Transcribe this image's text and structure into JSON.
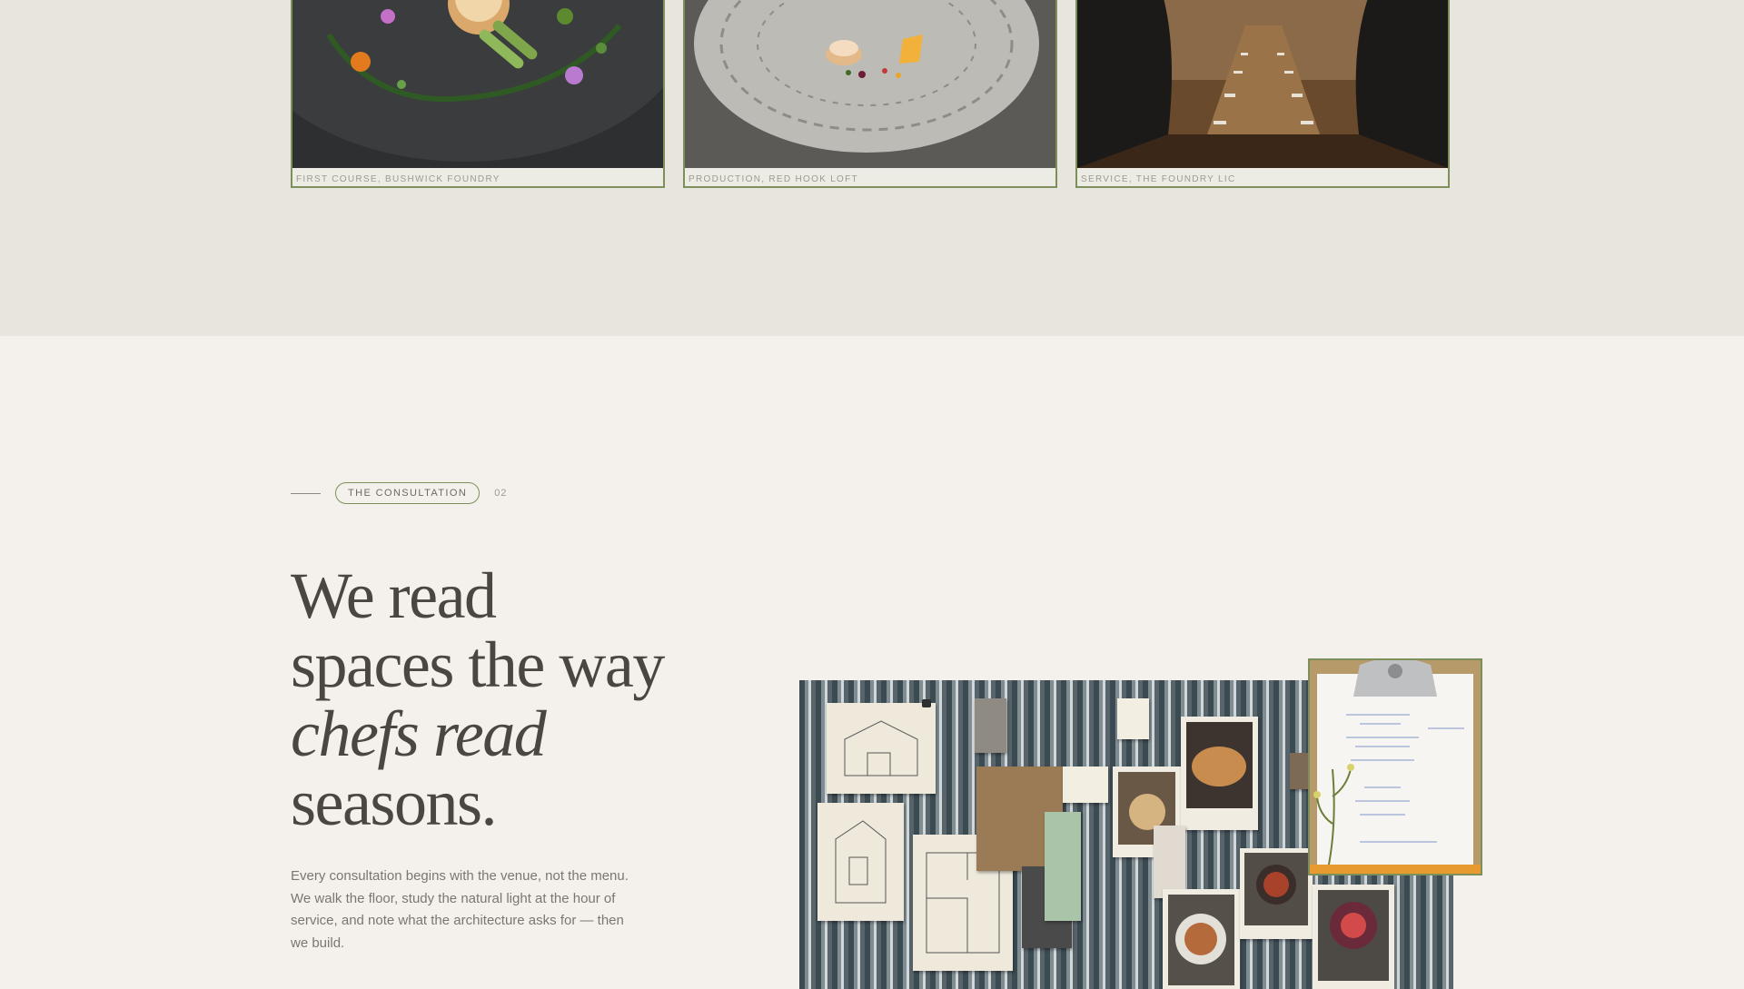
{
  "gallery": {
    "cards": [
      {
        "caption": "FIRST COURSE, BUSHWICK FOUNDRY"
      },
      {
        "caption": "PRODUCTION, RED HOOK LOFT"
      },
      {
        "caption": "SERVICE, THE FOUNDRY LIC"
      }
    ]
  },
  "section": {
    "eyebrow_label": "THE CONSULTATION",
    "eyebrow_number": "02",
    "headline": {
      "line1": "We read",
      "line2": "spaces the way",
      "line3_italic": "chefs read",
      "line4": "seasons."
    },
    "body": "Every consultation begins with the venue, not the menu. We walk the floor, study the natural light at the hour of service, and note what the architecture asks for — then we build."
  },
  "colors": {
    "accent_green": "#7d8f5a",
    "background": "#f4f1ec",
    "gallery_background": "#e8e5df",
    "text_dark": "#4a4741"
  }
}
